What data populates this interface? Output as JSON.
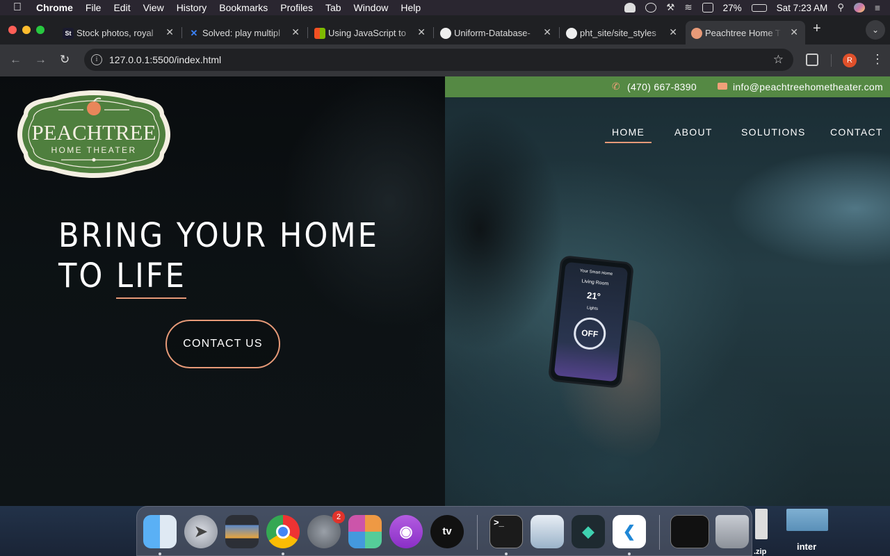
{
  "menubar": {
    "app_name": "Chrome",
    "items": [
      "File",
      "Edit",
      "View",
      "History",
      "Bookmarks",
      "Profiles",
      "Tab",
      "Window",
      "Help"
    ],
    "battery": "27%",
    "clock": "Sat 7:23 AM"
  },
  "tabs": [
    {
      "title": "Stock photos, royal",
      "favicon_text": "St",
      "favicon_color": "#1a1a2e"
    },
    {
      "title": "Solved: play multipl",
      "favicon_text": "✕",
      "favicon_color": "#3b82f6"
    },
    {
      "title": "Using JavaScript to",
      "favicon_text": "",
      "favicon_color": "#f25022"
    },
    {
      "title": "Uniform-Database-",
      "favicon_text": "",
      "favicon_color": "#24292e"
    },
    {
      "title": "pht_site/site_styles",
      "favicon_text": "",
      "favicon_color": "#24292e"
    },
    {
      "title": "Peachtree Home Th",
      "favicon_text": "",
      "favicon_color": "#e79a78",
      "active": true
    }
  ],
  "address_bar": {
    "url": "127.0.0.1:5500/index.html"
  },
  "profile_initial": "R",
  "site": {
    "phone": "(470) 667-8390",
    "email": "info@peachtreehometheater.com",
    "logo": {
      "line1": "PEACHTREE",
      "line2": "HOME THEATER"
    },
    "nav": [
      "HOME",
      "ABOUT",
      "SOLUTIONS",
      "CONTACT"
    ],
    "active_nav": "HOME",
    "hero": {
      "line1": "BRING YOUR HOME",
      "line2_prefix": "TO ",
      "line2_word": "LIFE"
    },
    "cta": "CONTACT US",
    "phone_screen": {
      "title": "Your Smart Home",
      "room": "Living Room",
      "temp": "21°",
      "lights": "Lights",
      "button": "OFF"
    }
  },
  "colors": {
    "accent": "#e79a78",
    "green": "#558944"
  },
  "dock": {
    "apps": [
      "Finder",
      "Launchpad",
      "Preview",
      "Chrome",
      "System Preferences",
      "Pixelmator",
      "Podcasts",
      "TV",
      "Terminal",
      "Preview Images",
      "Filmora",
      "Visual Studio Code",
      "Activity Monitor",
      "Trash"
    ],
    "badge_count": "2",
    "tv_label": "tv"
  },
  "desktop_files": [
    ".zip",
    "inter"
  ]
}
